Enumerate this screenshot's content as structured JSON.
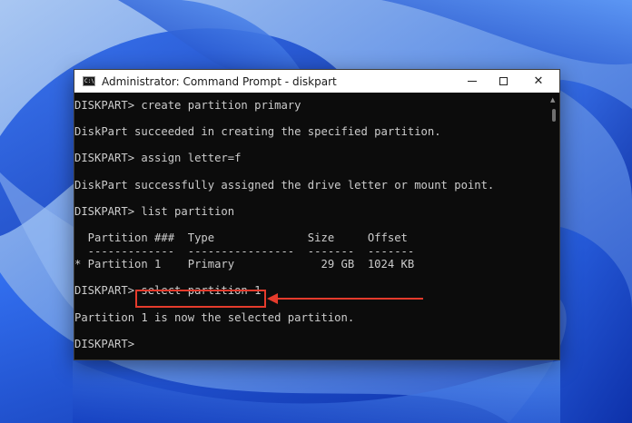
{
  "window": {
    "title": "Administrator: Command Prompt - diskpart",
    "icon_name": "cmd-icon",
    "icon_glyph": "C:\\"
  },
  "console": {
    "lines": [
      "DISKPART> create partition primary",
      "",
      "DiskPart succeeded in creating the specified partition.",
      "",
      "DISKPART> assign letter=f",
      "",
      "DiskPart successfully assigned the drive letter or mount point.",
      "",
      "DISKPART> list partition",
      "",
      "  Partition ###  Type              Size     Offset",
      "  -------------  ----------------  -------  -------",
      "* Partition 1    Primary             29 GB  1024 KB",
      "",
      "DISKPART> select partition 1",
      "",
      "Partition 1 is now the selected partition.",
      "",
      "DISKPART>"
    ]
  },
  "controls": {
    "minimize": "minimize-icon",
    "maximize": "maximize-icon",
    "close": "close-icon",
    "close_glyph": "✕"
  },
  "annotation": {
    "highlight_color": "#e53b2c",
    "arrow_color": "#e53b2c"
  }
}
